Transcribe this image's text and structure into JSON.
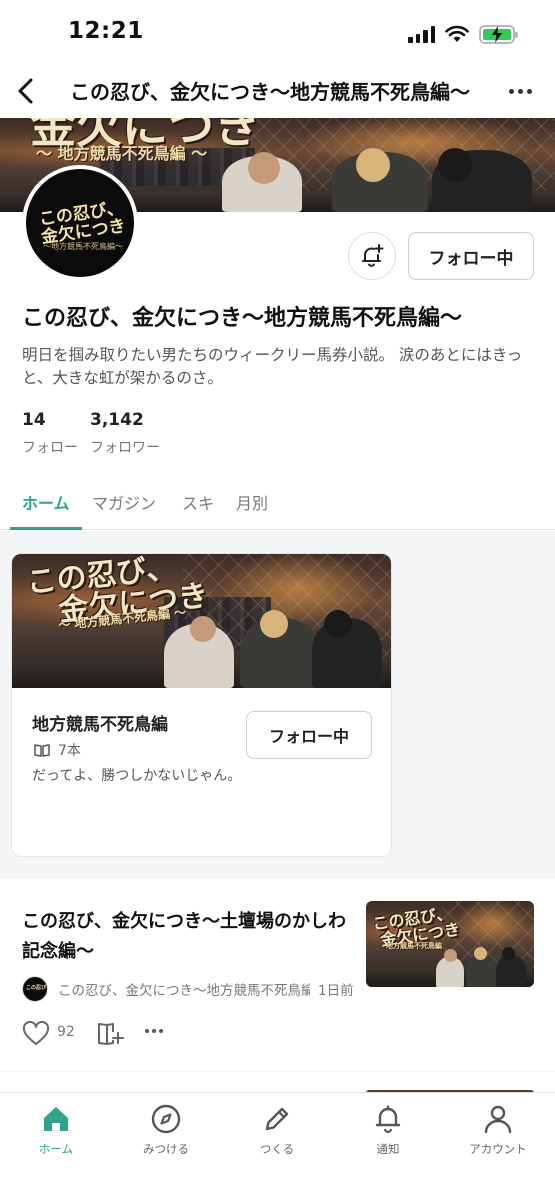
{
  "status_bar": {
    "time": "12:21"
  },
  "header": {
    "title": "この忍び、金欠につき〜地方競馬不死鳥編〜"
  },
  "banner": {
    "art_title": "金欠につき",
    "art_subtitle": "〜 地方競馬不死鳥編 〜"
  },
  "profile": {
    "avatar_line1": "この忍び、",
    "avatar_line2": "金欠につき",
    "avatar_line3": "〜地方競馬不死鳥編〜",
    "follow_label": "フォロー中",
    "name": "この忍び、金欠につき〜地方競馬不死鳥編〜",
    "bio": "明日を掴み取りたい男たちのウィークリー馬券小説。 涙のあとにはきっと、大きな虹が架かるのさ。",
    "stats": [
      {
        "value": "14",
        "label": "フォロー"
      },
      {
        "value": "3,142",
        "label": "フォロワー"
      }
    ]
  },
  "tabs": [
    {
      "label": "ホーム",
      "active": true
    },
    {
      "label": "マガジン",
      "active": false
    },
    {
      "label": "スキ",
      "active": false
    },
    {
      "label": "月別",
      "active": false
    }
  ],
  "magazine": {
    "art_title_line1": "この忍び、",
    "art_title_line2": "金欠につき",
    "art_subtitle": "〜 地方競馬不死鳥編 〜",
    "title": "地方競馬不死鳥編",
    "count": "7本",
    "description": "だってよ、勝つしかないじゃん。",
    "follow_label": "フォロー中"
  },
  "article": {
    "title": "この忍び、金欠につき〜土壇場のかしわ記念編〜",
    "thumb_title_line1": "この忍び、",
    "thumb_title_line2": "金欠につき",
    "thumb_subtitle": "地方競馬不死鳥編",
    "author": "この忍び、金欠につき〜地方競馬不死鳥編〜",
    "time": "1日前",
    "likes": "92"
  },
  "bottom_nav": [
    {
      "label": "ホーム",
      "icon": "home-icon",
      "active": true
    },
    {
      "label": "みつける",
      "icon": "compass-icon",
      "active": false
    },
    {
      "label": "つくる",
      "icon": "pencil-icon",
      "active": false
    },
    {
      "label": "通知",
      "icon": "bell-icon",
      "active": false
    },
    {
      "label": "アカウント",
      "icon": "person-icon",
      "active": false
    }
  ],
  "colors": {
    "accent": "#2fa38c",
    "battery": "#34c759"
  }
}
